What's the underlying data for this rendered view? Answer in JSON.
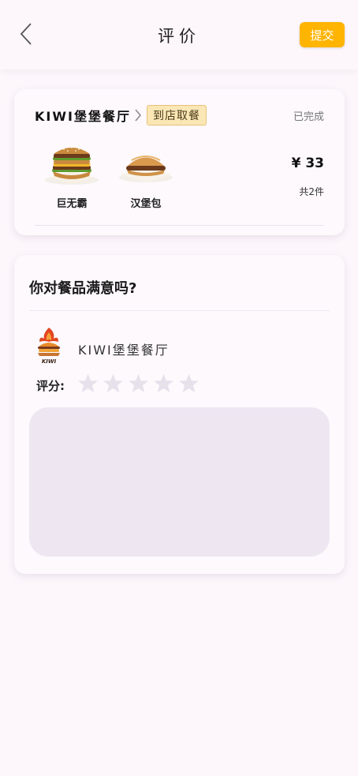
{
  "header": {
    "title": "评价",
    "submit_label": "提交"
  },
  "order": {
    "shop_name": "KIWI堡堡餐厅",
    "pickup_tag": "到店取餐",
    "status": "已完成",
    "products": [
      {
        "name": "巨无霸",
        "icon": "big-burger-image"
      },
      {
        "name": "汉堡包",
        "icon": "hamburger-image"
      }
    ],
    "price": "¥ 33",
    "count": "共2件"
  },
  "review": {
    "question": "你对餐品满意吗?",
    "shop_name": "KIWI堡堡餐厅",
    "logo_text": "KIWI",
    "rating_label": "评分:",
    "rating": 0,
    "max_rating": 5,
    "comment_value": "",
    "comment_placeholder": ""
  },
  "colors": {
    "accent": "#ffb400",
    "background": "#fdf7fc",
    "tag_bg": "#fbe7b5",
    "star_inactive": "#e7e1ec",
    "textarea_bg": "#eee7f2"
  }
}
